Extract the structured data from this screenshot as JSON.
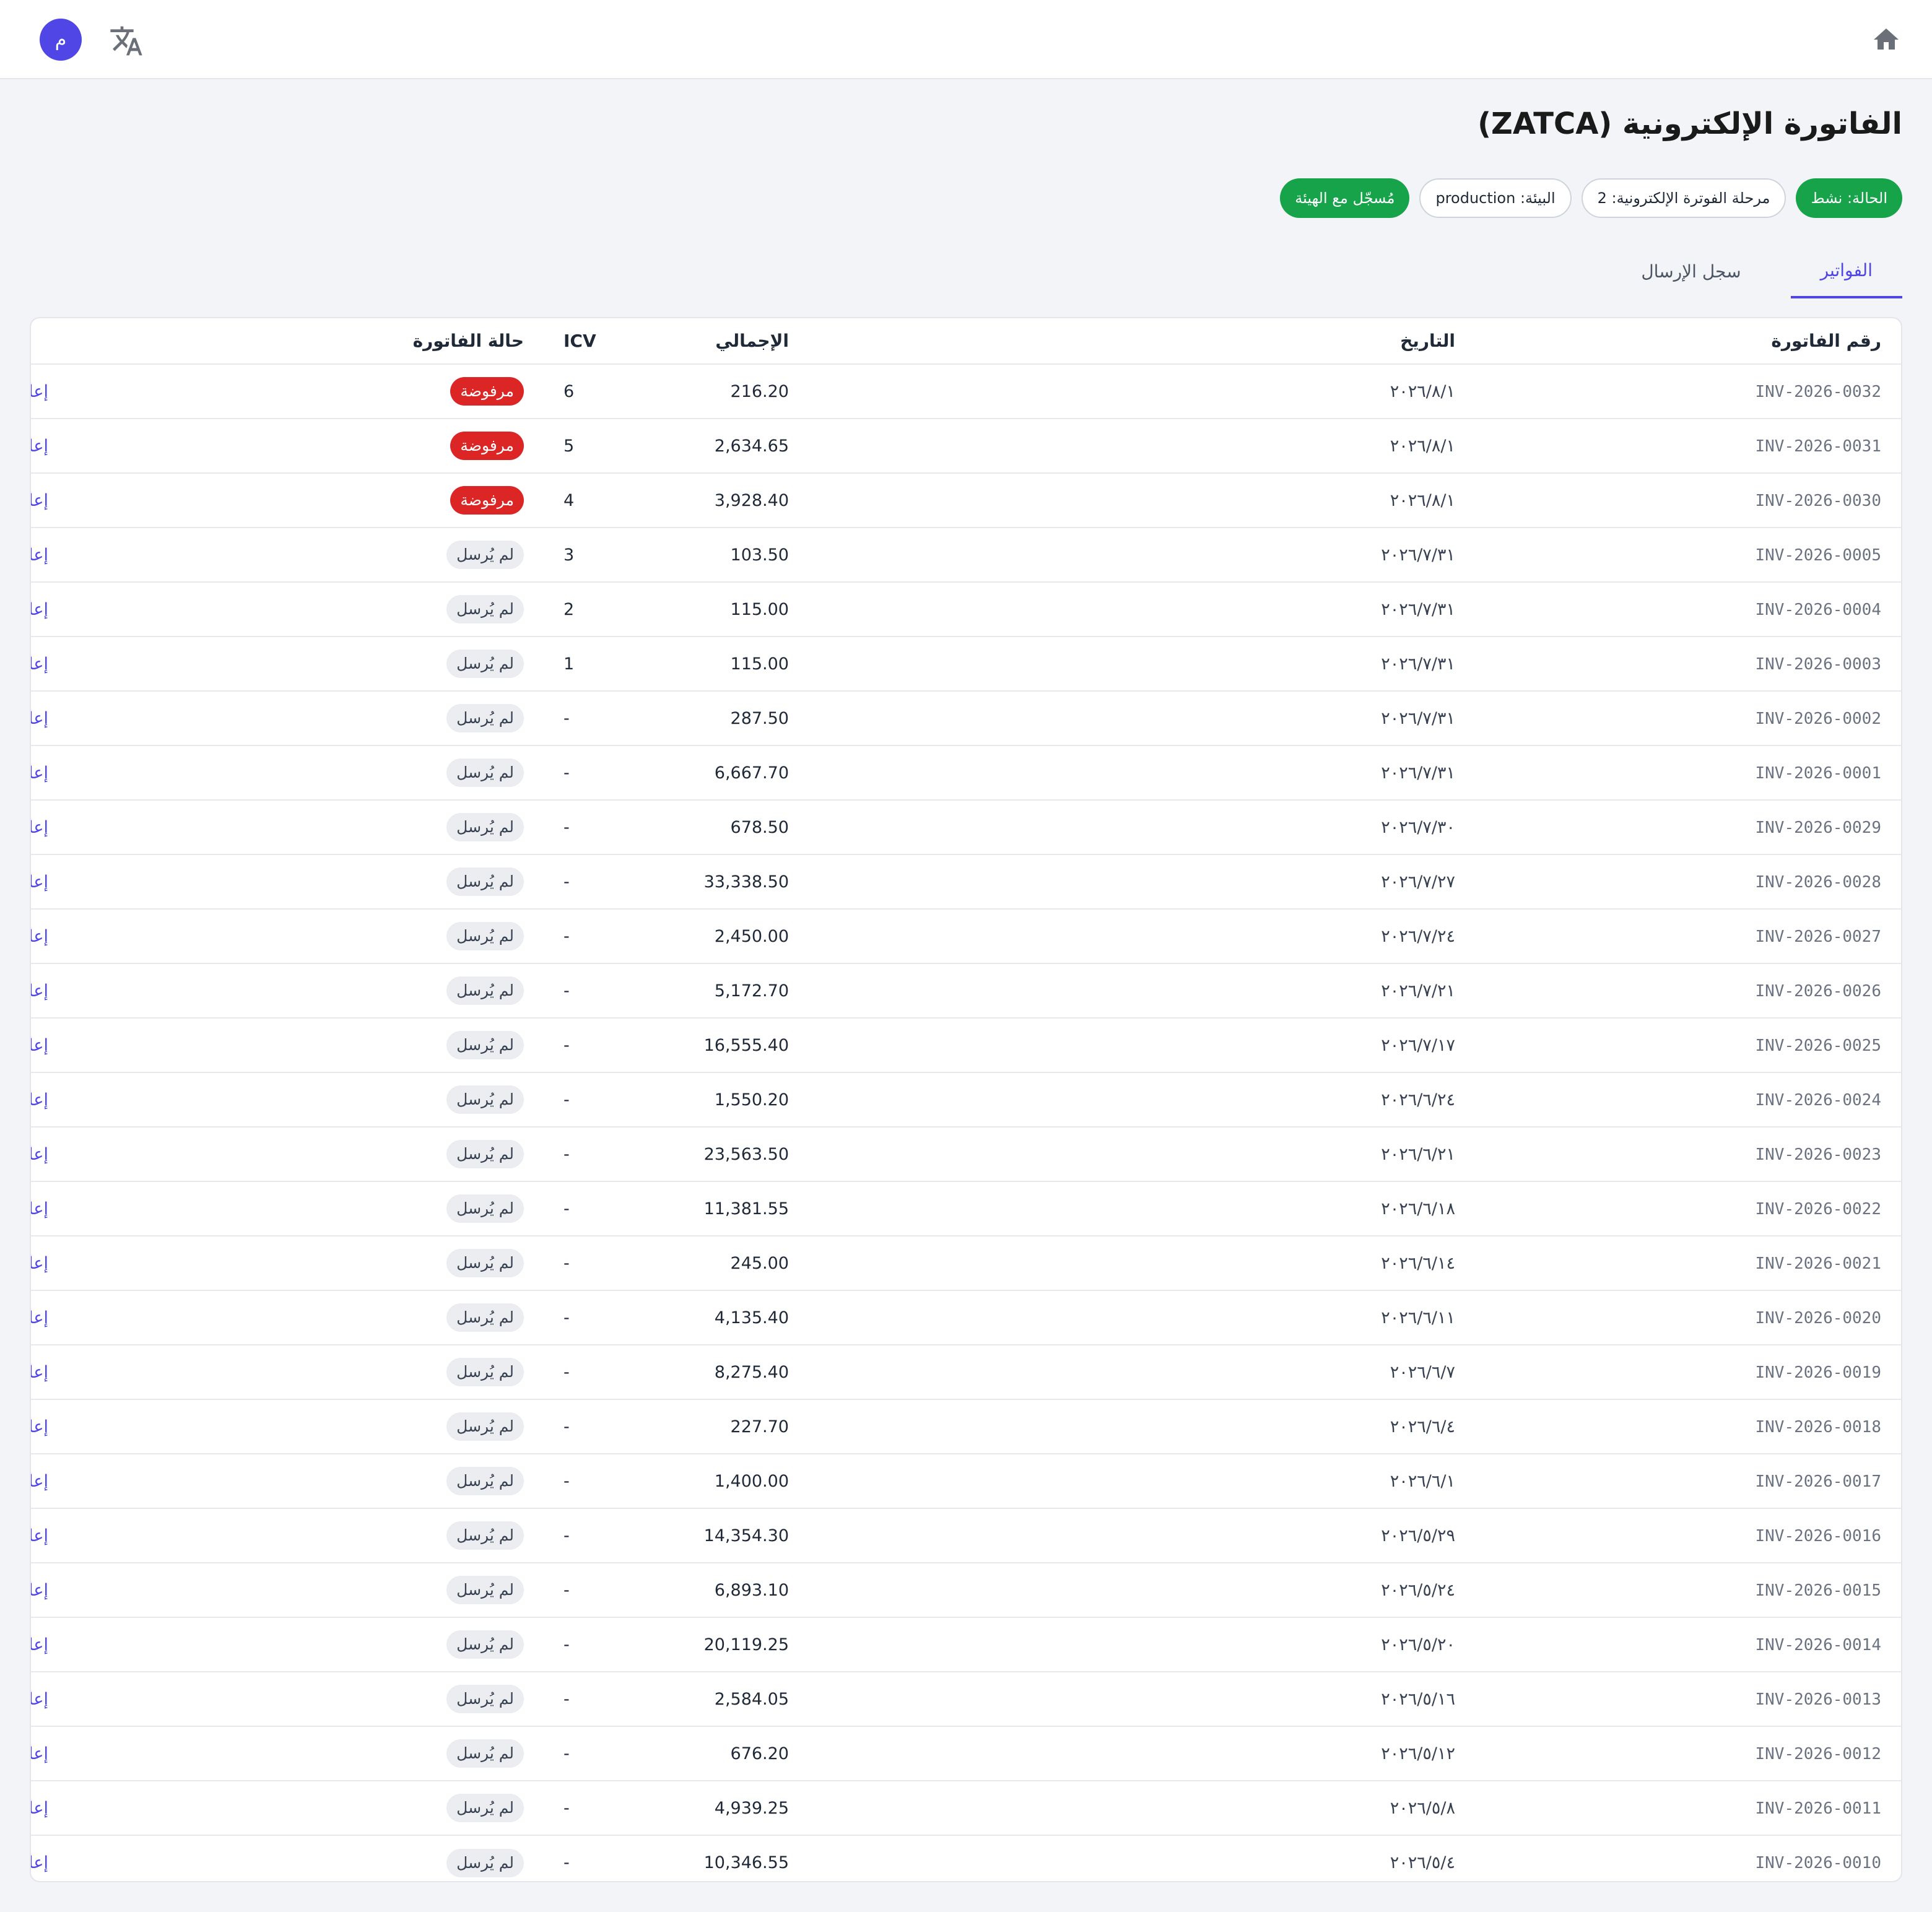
{
  "topbar": {
    "home_icon": "home-icon",
    "language_icon": "translate-icon",
    "avatar_initial": "م"
  },
  "page": {
    "title": "الفاتورة الإلكترونية (ZATCA)"
  },
  "badges": {
    "status": "الحالة: نشط",
    "phase": "مرحلة الفوترة الإلكترونية: 2",
    "environment": "البيئة: production",
    "registered": "مُسجّل مع الهيئة"
  },
  "tabs": {
    "invoices": "الفواتير",
    "submission_log": "سجل الإرسال"
  },
  "table": {
    "headers": {
      "invoice_no": "رقم الفاتورة",
      "date": "التاريخ",
      "total": "الإجمالي",
      "icv": "ICV",
      "status": "حالة الفاتورة"
    },
    "rows": [
      {
        "invoice_no": "INV-2026-0032",
        "date": "٢٠٢٦/٨/١",
        "total": "216.20",
        "icv": "6",
        "status": "مرفوضة",
        "status_type": "rejected",
        "action": "إعادة إرسال"
      },
      {
        "invoice_no": "INV-2026-0031",
        "date": "٢٠٢٦/٨/١",
        "total": "2,634.65",
        "icv": "5",
        "status": "مرفوضة",
        "status_type": "rejected",
        "action": "إعادة إرسال"
      },
      {
        "invoice_no": "INV-2026-0030",
        "date": "٢٠٢٦/٨/١",
        "total": "3,928.40",
        "icv": "4",
        "status": "مرفوضة",
        "status_type": "rejected",
        "action": "إعادة إرسال"
      },
      {
        "invoice_no": "INV-2026-0005",
        "date": "٢٠٢٦/٧/٣١",
        "total": "103.50",
        "icv": "3",
        "status": "لم يُرسل",
        "status_type": "not-sent",
        "action": "إعادة إرسال"
      },
      {
        "invoice_no": "INV-2026-0004",
        "date": "٢٠٢٦/٧/٣١",
        "total": "115.00",
        "icv": "2",
        "status": "لم يُرسل",
        "status_type": "not-sent",
        "action": "إعادة إرسال"
      },
      {
        "invoice_no": "INV-2026-0003",
        "date": "٢٠٢٦/٧/٣١",
        "total": "115.00",
        "icv": "1",
        "status": "لم يُرسل",
        "status_type": "not-sent",
        "action": "إعادة إرسال"
      },
      {
        "invoice_no": "INV-2026-0002",
        "date": "٢٠٢٦/٧/٣١",
        "total": "287.50",
        "icv": "-",
        "status": "لم يُرسل",
        "status_type": "not-sent",
        "action": "إعادة إرسال"
      },
      {
        "invoice_no": "INV-2026-0001",
        "date": "٢٠٢٦/٧/٣١",
        "total": "6,667.70",
        "icv": "-",
        "status": "لم يُرسل",
        "status_type": "not-sent",
        "action": "إعادة إرسال"
      },
      {
        "invoice_no": "INV-2026-0029",
        "date": "٢٠٢٦/٧/٣٠",
        "total": "678.50",
        "icv": "-",
        "status": "لم يُرسل",
        "status_type": "not-sent",
        "action": "إعادة إرسال"
      },
      {
        "invoice_no": "INV-2026-0028",
        "date": "٢٠٢٦/٧/٢٧",
        "total": "33,338.50",
        "icv": "-",
        "status": "لم يُرسل",
        "status_type": "not-sent",
        "action": "إعادة إرسال"
      },
      {
        "invoice_no": "INV-2026-0027",
        "date": "٢٠٢٦/٧/٢٤",
        "total": "2,450.00",
        "icv": "-",
        "status": "لم يُرسل",
        "status_type": "not-sent",
        "action": "إعادة إرسال"
      },
      {
        "invoice_no": "INV-2026-0026",
        "date": "٢٠٢٦/٧/٢١",
        "total": "5,172.70",
        "icv": "-",
        "status": "لم يُرسل",
        "status_type": "not-sent",
        "action": "إعادة إرسال"
      },
      {
        "invoice_no": "INV-2026-0025",
        "date": "٢٠٢٦/٧/١٧",
        "total": "16,555.40",
        "icv": "-",
        "status": "لم يُرسل",
        "status_type": "not-sent",
        "action": "إعادة إرسال"
      },
      {
        "invoice_no": "INV-2026-0024",
        "date": "٢٠٢٦/٦/٢٤",
        "total": "1,550.20",
        "icv": "-",
        "status": "لم يُرسل",
        "status_type": "not-sent",
        "action": "إعادة إرسال"
      },
      {
        "invoice_no": "INV-2026-0023",
        "date": "٢٠٢٦/٦/٢١",
        "total": "23,563.50",
        "icv": "-",
        "status": "لم يُرسل",
        "status_type": "not-sent",
        "action": "إعادة إرسال"
      },
      {
        "invoice_no": "INV-2026-0022",
        "date": "٢٠٢٦/٦/١٨",
        "total": "11,381.55",
        "icv": "-",
        "status": "لم يُرسل",
        "status_type": "not-sent",
        "action": "إعادة إرسال"
      },
      {
        "invoice_no": "INV-2026-0021",
        "date": "٢٠٢٦/٦/١٤",
        "total": "245.00",
        "icv": "-",
        "status": "لم يُرسل",
        "status_type": "not-sent",
        "action": "إعادة إرسال"
      },
      {
        "invoice_no": "INV-2026-0020",
        "date": "٢٠٢٦/٦/١١",
        "total": "4,135.40",
        "icv": "-",
        "status": "لم يُرسل",
        "status_type": "not-sent",
        "action": "إعادة إرسال"
      },
      {
        "invoice_no": "INV-2026-0019",
        "date": "٢٠٢٦/٦/٧",
        "total": "8,275.40",
        "icv": "-",
        "status": "لم يُرسل",
        "status_type": "not-sent",
        "action": "إعادة إرسال"
      },
      {
        "invoice_no": "INV-2026-0018",
        "date": "٢٠٢٦/٦/٤",
        "total": "227.70",
        "icv": "-",
        "status": "لم يُرسل",
        "status_type": "not-sent",
        "action": "إعادة إرسال"
      },
      {
        "invoice_no": "INV-2026-0017",
        "date": "٢٠٢٦/٦/١",
        "total": "1,400.00",
        "icv": "-",
        "status": "لم يُرسل",
        "status_type": "not-sent",
        "action": "إعادة إرسال"
      },
      {
        "invoice_no": "INV-2026-0016",
        "date": "٢٠٢٦/٥/٢٩",
        "total": "14,354.30",
        "icv": "-",
        "status": "لم يُرسل",
        "status_type": "not-sent",
        "action": "إعادة إرسال"
      },
      {
        "invoice_no": "INV-2026-0015",
        "date": "٢٠٢٦/٥/٢٤",
        "total": "6,893.10",
        "icv": "-",
        "status": "لم يُرسل",
        "status_type": "not-sent",
        "action": "إعادة إرسال"
      },
      {
        "invoice_no": "INV-2026-0014",
        "date": "٢٠٢٦/٥/٢٠",
        "total": "20,119.25",
        "icv": "-",
        "status": "لم يُرسل",
        "status_type": "not-sent",
        "action": "إعادة إرسال"
      },
      {
        "invoice_no": "INV-2026-0013",
        "date": "٢٠٢٦/٥/١٦",
        "total": "2,584.05",
        "icv": "-",
        "status": "لم يُرسل",
        "status_type": "not-sent",
        "action": "إعادة إرسال"
      },
      {
        "invoice_no": "INV-2026-0012",
        "date": "٢٠٢٦/٥/١٢",
        "total": "676.20",
        "icv": "-",
        "status": "لم يُرسل",
        "status_type": "not-sent",
        "action": "إعادة إرسال"
      },
      {
        "invoice_no": "INV-2026-0011",
        "date": "٢٠٢٦/٥/٨",
        "total": "4,939.25",
        "icv": "-",
        "status": "لم يُرسل",
        "status_type": "not-sent",
        "action": "إعادة إرسال"
      },
      {
        "invoice_no": "INV-2026-0010",
        "date": "٢٠٢٦/٥/٤",
        "total": "10,346.55",
        "icv": "-",
        "status": "لم يُرسل",
        "status_type": "not-sent",
        "action": "إعادة إرسال"
      }
    ]
  }
}
